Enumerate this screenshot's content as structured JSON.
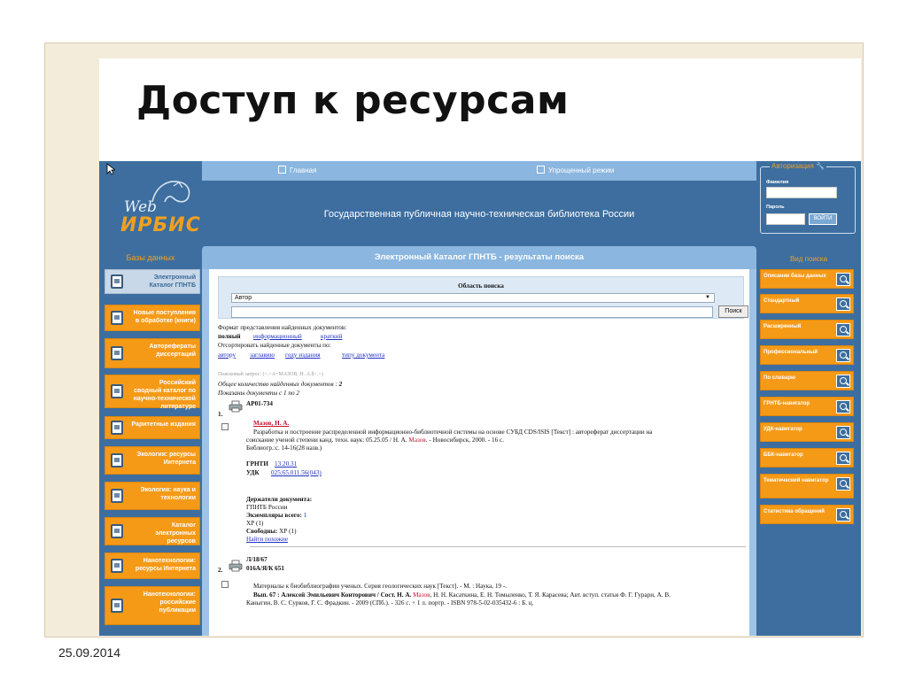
{
  "slide": {
    "title": "Доступ к ресурсам",
    "date": "25.09.2014"
  },
  "app": {
    "logo_web": "Web",
    "logo_irbis": "ИРБИС",
    "top_links": [
      "Главная",
      "Упрощенный режим"
    ],
    "site_title": "Государственная публичная научно-техническая библиотека России"
  },
  "databases": {
    "header": "Базы данных",
    "items": [
      "Электронный Каталог ГПНТБ",
      "Новые поступления в обработке (книги)",
      "Авторефераты диссертаций",
      "Российский сводный каталог по научно-технической литературе",
      "Раритетные издания",
      "Экология: ресурсы Интернета",
      "Экология: наука и технологии",
      "Каталог электронных ресурсов",
      "Нанотехнологии: ресурсы Интернета",
      "Нанотехнологии: российские публикации"
    ]
  },
  "auth": {
    "title": "Авторизация",
    "surname_label": "Фамилия",
    "password_label": "Пароль",
    "login_button": "ВОЙТИ"
  },
  "view": {
    "header": "Вид поиска",
    "items": [
      "Описание базы данных",
      "Стандартный",
      "Расширенный",
      "Профессиональный",
      "По словарю",
      "ГРНТБ-навигатор",
      "УДК-навигатор",
      "ББК-навигатор",
      "Тематический навигатор",
      "Статистика обращений"
    ]
  },
  "results": {
    "header": "Электронный Каталог ГПНТБ - результаты поиска",
    "search_area_label": "Область поиска",
    "search_field_value": "Автор",
    "search_button": "Поиск",
    "format_label": "Формат представления найденных документов:",
    "format_options": [
      "полный",
      "информационный",
      "краткий"
    ],
    "sort_label": "Отсортировать найденные документы по:",
    "sort_options": [
      "автору",
      "заглавию",
      "году издания",
      "типу документа"
    ],
    "query": "Поисковый запрос: (<.>A=МАЗОВ, Н. А.$<.>)",
    "total_label": "Общее количество найденных документов :",
    "total": "2",
    "shown": "Показаны документы с 1 по 2",
    "doc1": {
      "num": "1.",
      "code": "АР01-734",
      "author": "Мазов, Н. А.",
      "text1": "Разработка и построение распределенной информационно-библиотечной системы на основе СУБД CDS/ISIS [Текст] : автореферат диссертации на",
      "text2a": "соискание ученой степени канд. техн. наук: 05.25.05 / Н. А.",
      "text2_author": "Мазов",
      "text2b": ". - Новосибирск, 2000. - 16 с.",
      "text3": "Библиогр.:с. 14-16(28 назв.)",
      "grnti_label": "ГРНТИ",
      "grnti_value": "13.20.31",
      "udk_label": "УДК",
      "udk_value": "025:65.011.56(043)",
      "holders_label": "Держатели документа:",
      "holder": "ГПНТБ России",
      "copies_label": "Экземпляры всего:",
      "copies": "1",
      "xp": "ХР (1)",
      "free_label": "Свободны:",
      "free": "ХР (1)",
      "similar": "Найти похожие"
    },
    "doc2": {
      "num": "2.",
      "code": "Л/18/67",
      "shelf": "016А/Я/К 651",
      "text1": "Материалы к биобиблиографии ученых. Серия геологических наук [Текст]. - М. : Наука, 19 -.",
      "text2a": "Вып. 67 : Алексей Эмильевич Конторович / Сост. Н. А.",
      "text2_author": "Мазов",
      "text2b": ", Н. Н. Касаткина, Е. Н. Томыленко, Т. Я. Карасева; Авт. вступ. статьи Ф. Г. Гурари, А. В.",
      "text3": "Каныгин, В. С. Сурков, Г. С. Фрадкин. - 2009 (СПб.). - 326 с. + 1 л. портр. - ISBN 978-5-02-035432-6 : Б. ц."
    }
  }
}
